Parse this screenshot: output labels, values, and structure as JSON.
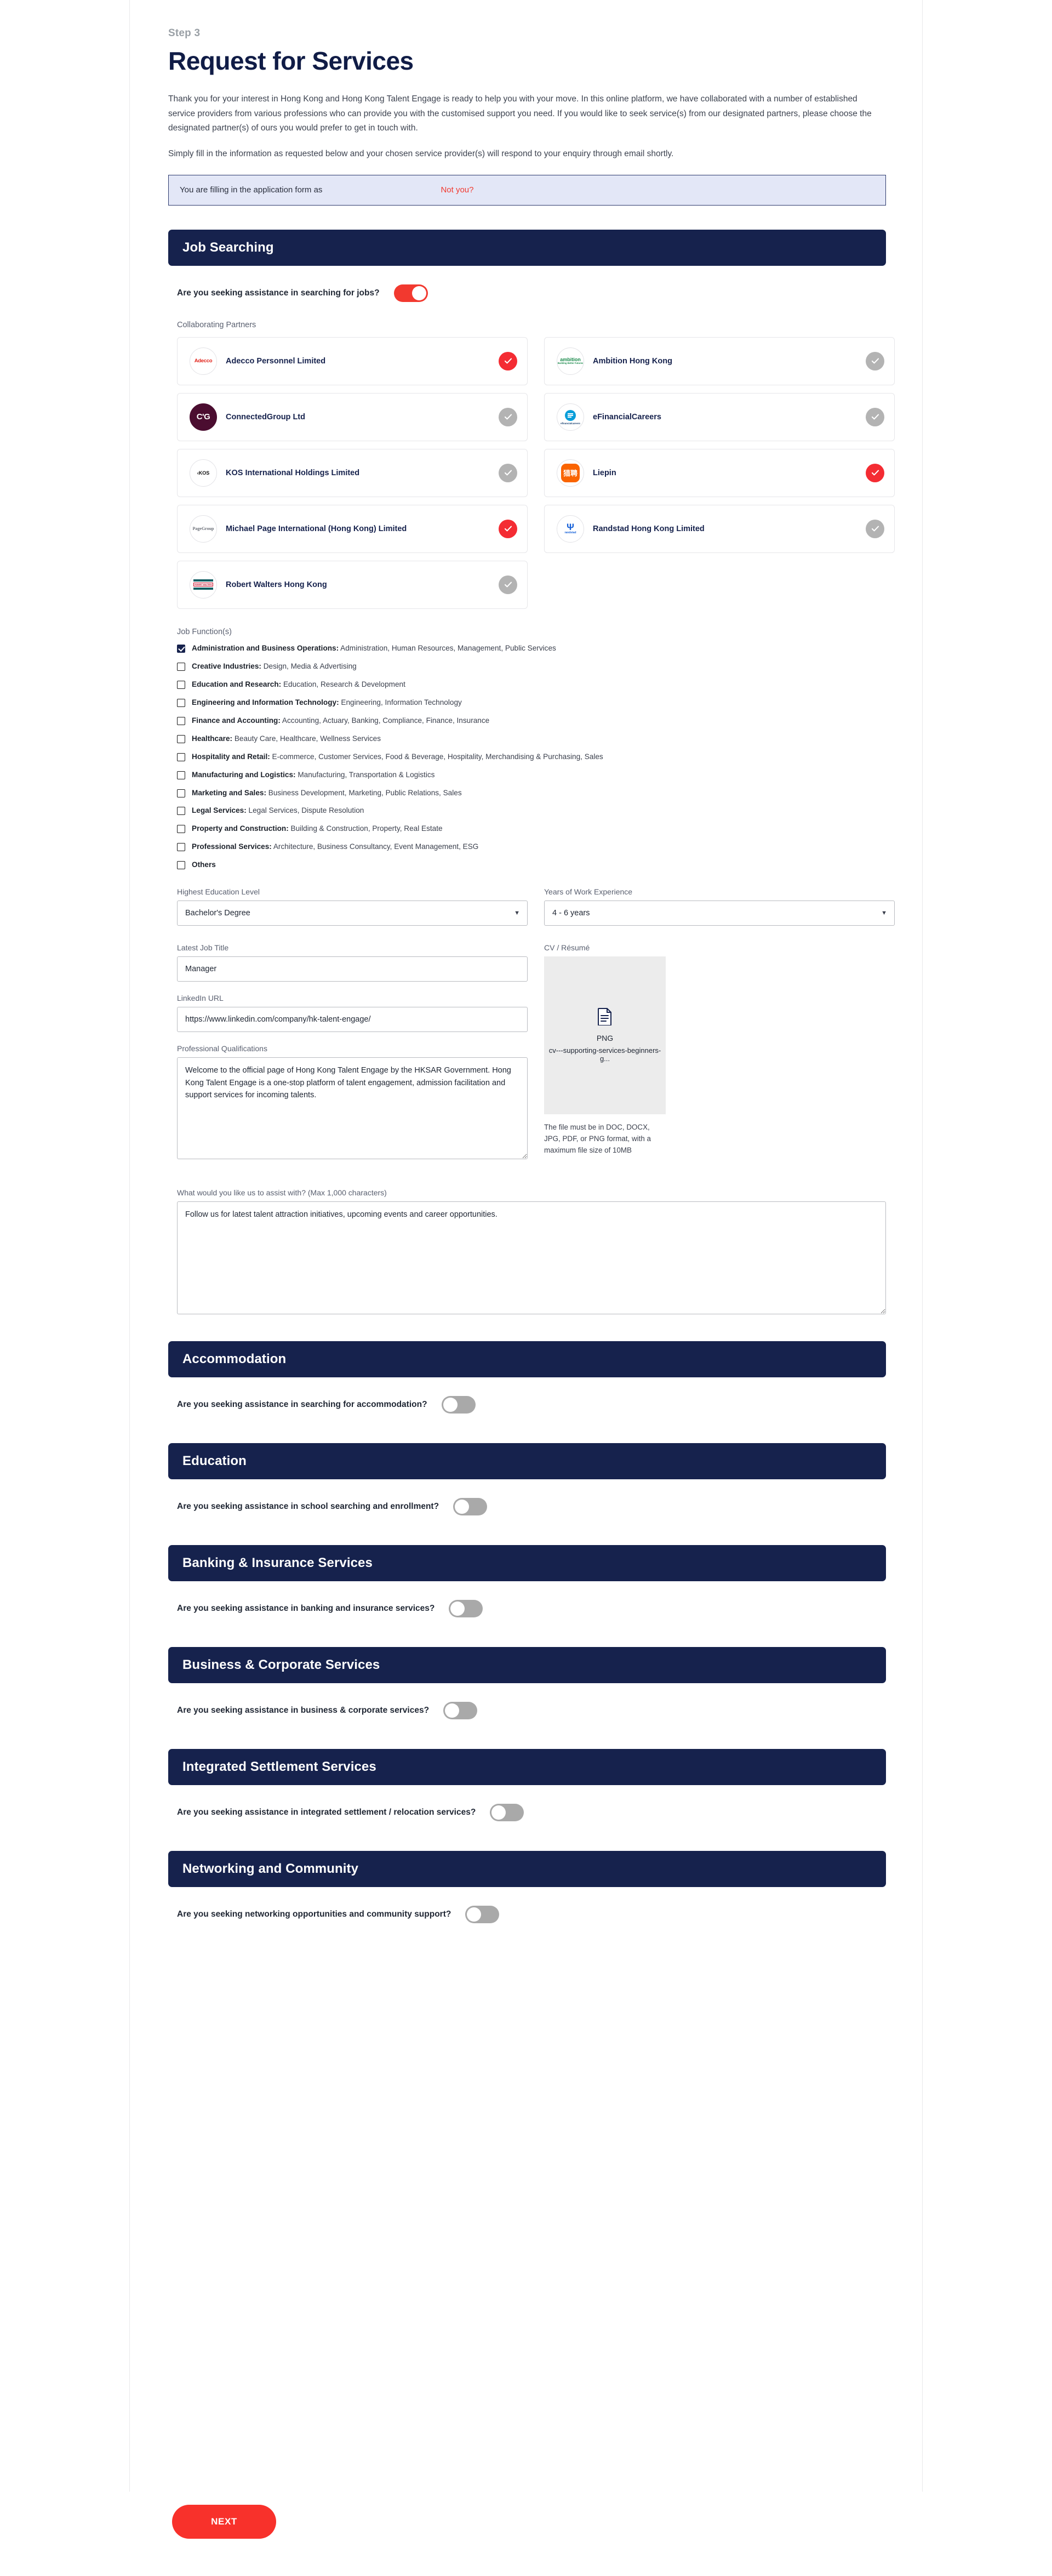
{
  "header": {
    "step": "Step 3",
    "title": "Request for Services",
    "paragraph1": "Thank you for your interest in Hong Kong and Hong Kong Talent Engage is ready to help you with your move. In this online platform, we have collaborated with a number of established service providers from various professions who can provide you with the customised support you need. If you would like to seek service(s) from our designated partners, please choose the designated partner(s) of ours you would prefer to get in touch with.",
    "paragraph2": "Simply fill in the information as requested below and your chosen service provider(s) will respond to your enquiry through email shortly."
  },
  "notice": {
    "text": "You are filling in the application form as",
    "link": "Not you?"
  },
  "job_searching": {
    "heading": "Job Searching",
    "toggle_question": "Are you seeking assistance in searching for jobs?",
    "toggle_state": "on",
    "partners_label": "Collaborating Partners",
    "partners": [
      {
        "name": "Adecco Personnel Limited",
        "logo": "adecco-logo",
        "logo_text": "Adecco",
        "selected": true
      },
      {
        "name": "Ambition Hong Kong",
        "logo": "ambition-logo",
        "logo_text": "ambition",
        "logo_sub": "Building Better Futures",
        "selected": false
      },
      {
        "name": "ConnectedGroup Ltd",
        "logo": "connectedgroup-logo",
        "logo_text": "C'G",
        "selected": false
      },
      {
        "name": "eFinancialCareers",
        "logo": "efinancialcareers-logo",
        "logo_text": "efinancialcareers",
        "selected": false
      },
      {
        "name": "KOS International Holdings Limited",
        "logo": "kos-logo",
        "logo_text": "‹KOS",
        "selected": false
      },
      {
        "name": "Liepin",
        "logo": "liepin-logo",
        "logo_text": "猎聘",
        "selected": true
      },
      {
        "name": "Michael Page International (Hong Kong) Limited",
        "logo": "pagegroup-logo",
        "logo_text": "PageGroup",
        "selected": true
      },
      {
        "name": "Randstad Hong Kong Limited",
        "logo": "randstad-logo",
        "logo_text": "randstad",
        "selected": false
      },
      {
        "name": "Robert Walters Hong Kong",
        "logo": "robertwalters-logo",
        "logo_text": "ROBERT WALTERS",
        "selected": false
      }
    ],
    "job_functions_label": "Job Function(s)",
    "job_functions": [
      {
        "title": "Administration and Business Operations:",
        "detail": "Administration, Human Resources, Management, Public Services",
        "checked": true
      },
      {
        "title": "Creative Industries:",
        "detail": "Design, Media & Advertising",
        "checked": false
      },
      {
        "title": "Education and Research:",
        "detail": "Education, Research & Development",
        "checked": false
      },
      {
        "title": "Engineering and Information Technology:",
        "detail": "Engineering, Information Technology",
        "checked": false
      },
      {
        "title": "Finance and Accounting:",
        "detail": "Accounting, Actuary, Banking, Compliance, Finance, Insurance",
        "checked": false
      },
      {
        "title": "Healthcare:",
        "detail": "Beauty Care, Healthcare, Wellness Services",
        "checked": false
      },
      {
        "title": "Hospitality and Retail:",
        "detail": "E-commerce, Customer Services, Food & Beverage, Hospitality, Merchandising & Purchasing, Sales",
        "checked": false
      },
      {
        "title": "Manufacturing and Logistics:",
        "detail": "Manufacturing, Transportation & Logistics",
        "checked": false
      },
      {
        "title": "Marketing and Sales:",
        "detail": "Business Development, Marketing, Public Relations, Sales",
        "checked": false
      },
      {
        "title": "Legal Services:",
        "detail": "Legal Services, Dispute Resolution",
        "checked": false
      },
      {
        "title": "Property and Construction:",
        "detail": "Building & Construction, Property, Real Estate",
        "checked": false
      },
      {
        "title": "Professional Services:",
        "detail": "Architecture, Business Consultancy, Event Management, ESG",
        "checked": false
      },
      {
        "title": "Others",
        "detail": "",
        "checked": false
      }
    ],
    "education_level": {
      "label": "Highest Education Level",
      "value": "Bachelor's Degree",
      "options": [
        "Bachelor's Degree"
      ]
    },
    "work_experience": {
      "label": "Years of Work Experience",
      "value": "4 - 6 years",
      "options": [
        "4 - 6 years"
      ]
    },
    "job_title": {
      "label": "Latest Job Title",
      "value": "Manager"
    },
    "linkedin": {
      "label": "LinkedIn URL",
      "value": "https://www.linkedin.com/company/hk-talent-engage/"
    },
    "qualifications": {
      "label": "Professional Qualifications",
      "value": "Welcome to the official page of Hong Kong Talent Engage by the HKSAR Government. Hong Kong Talent Engage is a one-stop platform of talent engagement, admission facilitation and support services for incoming talents."
    },
    "cv": {
      "label": "CV / Résumé",
      "file_type": "PNG",
      "file_name": "cv---supporting-services-beginners-g...",
      "hint": "The file must be in DOC, DOCX, JPG, PDF, or PNG format, with a maximum file size of 10MB"
    },
    "assist": {
      "label": "What would you like us to assist with? (Max 1,000 characters)",
      "value": "Follow us for latest talent attraction initiatives, upcoming events and career opportunities."
    }
  },
  "other_sections": [
    {
      "heading": "Accommodation",
      "question": "Are you seeking assistance in searching for accommodation?",
      "toggle_state": "off"
    },
    {
      "heading": "Education",
      "question": "Are you seeking assistance in school searching and enrollment?",
      "toggle_state": "off"
    },
    {
      "heading": "Banking & Insurance Services",
      "question": "Are you seeking assistance in banking and insurance services?",
      "toggle_state": "off"
    },
    {
      "heading": "Business & Corporate Services",
      "question": "Are you seeking assistance in business & corporate services?",
      "toggle_state": "off"
    },
    {
      "heading": "Integrated Settlement Services",
      "question": "Are you seeking assistance in integrated settlement / relocation services?",
      "toggle_state": "off"
    },
    {
      "heading": "Networking and Community",
      "question": "Are you seeking networking opportunities and community support?",
      "toggle_state": "off"
    }
  ],
  "footer": {
    "next_label": "NEXT"
  },
  "colors": {
    "navy": "#16224d",
    "red": "#f8312b",
    "toggle_on": "#f2392f",
    "toggle_off": "#a9a9a9",
    "notice_bg": "#e3e7f7"
  }
}
